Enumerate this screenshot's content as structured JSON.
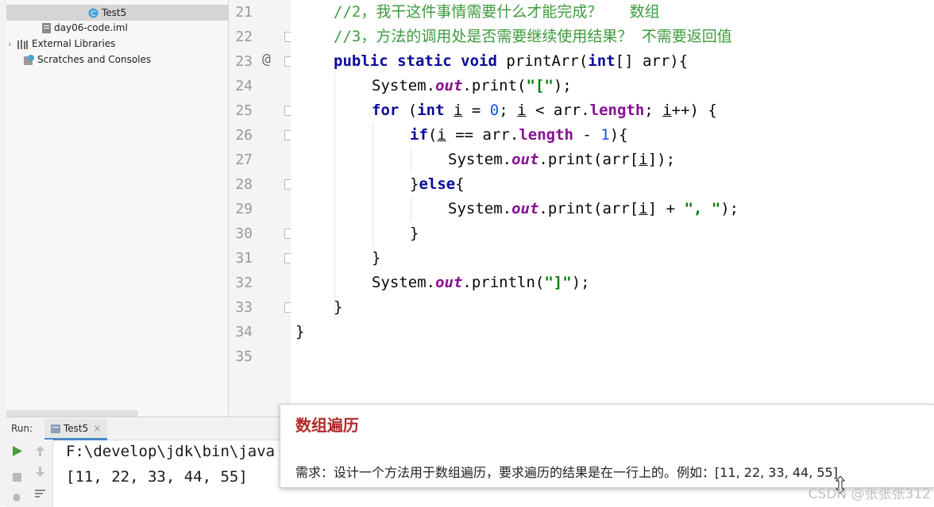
{
  "project_tree": {
    "items": [
      {
        "label": "Test5",
        "icon": "java-class-icon",
        "selected": true
      },
      {
        "label": "day06-code.iml",
        "icon": "iml-file-icon"
      },
      {
        "label": "External Libraries",
        "icon": "library-icon"
      },
      {
        "label": "Scratches and Consoles",
        "icon": "scratches-icon"
      }
    ]
  },
  "editor": {
    "line_numbers": [
      "21",
      "22",
      "23",
      "24",
      "25",
      "26",
      "27",
      "28",
      "29",
      "30",
      "31",
      "32",
      "33",
      "34",
      "35"
    ],
    "annotation_marker": "@",
    "code": {
      "l21": "//2，我干这件事情需要什么才能完成？   数组",
      "l22": "//3，方法的调用处是否需要继续使用结果？ 不需要返回值",
      "l23_kw": "public static void",
      "l23_rest": " printArr(",
      "l23_kw2": "int",
      "l23_end": "[] arr){",
      "l24_a": "System.",
      "l24_fld": "out",
      "l24_b": ".print(",
      "l24_str": "\"[\"",
      "l24_c": ");",
      "l25_kw": "for",
      "l25_a": " (",
      "l25_kw2": "int",
      "l25_b": " ",
      "l25_i1": "i",
      "l25_c": " = ",
      "l25_num": "0",
      "l25_d": "; ",
      "l25_i2": "i",
      "l25_e": " < arr.",
      "l25_prop": "length",
      "l25_f": "; ",
      "l25_i3": "i",
      "l25_g": "++) {",
      "l26_kw": "if",
      "l26_a": "(",
      "l26_i": "i",
      "l26_b": " == arr.",
      "l26_prop": "length",
      "l26_c": " - ",
      "l26_num": "1",
      "l26_d": "){",
      "l27_a": "System.",
      "l27_fld": "out",
      "l27_b": ".print(arr[",
      "l27_i": "i",
      "l27_c": "]);",
      "l28_a": "}",
      "l28_kw": "else",
      "l28_b": "{",
      "l29_a": "System.",
      "l29_fld": "out",
      "l29_b": ".print(arr[",
      "l29_i": "i",
      "l29_c": "] + ",
      "l29_str": "\", \"",
      "l29_d": ");",
      "l30": "}",
      "l31": "}",
      "l32_a": "System.",
      "l32_fld": "out",
      "l32_b": ".println(",
      "l32_str": "\"]\"",
      "l32_c": ");",
      "l33": "}",
      "l34": "}"
    }
  },
  "run_panel": {
    "label": "Run:",
    "tab": "Test5",
    "console": [
      "F:\\develop\\jdk\\bin\\java",
      "[11, 22, 33, 44, 55]"
    ]
  },
  "card": {
    "title": "数组遍历",
    "body": "需求：设计一个方法用于数组遍历，要求遍历的结果是在一行上的。例如：[11, 22, 33, 44, 55]"
  },
  "watermark": "CSDN @张张张312"
}
